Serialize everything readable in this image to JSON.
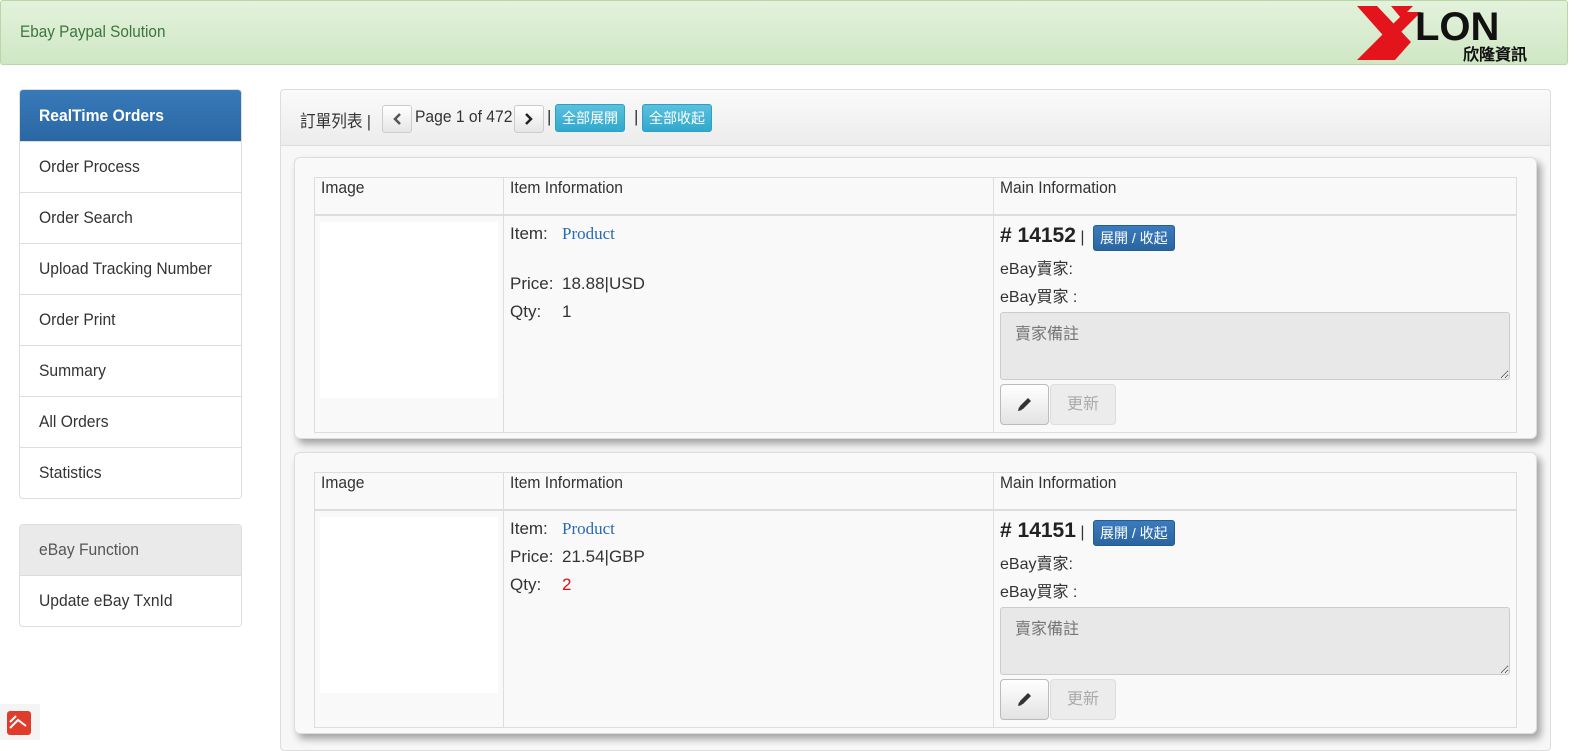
{
  "header": {
    "brand": "Ebay Paypal Solution",
    "logo_text": "LON",
    "logo_sub": "欣隆資訊"
  },
  "sidebar": {
    "items": [
      {
        "label": "RealTime Orders"
      },
      {
        "label": "Order Process"
      },
      {
        "label": "Order Search"
      },
      {
        "label": "Upload Tracking Number"
      },
      {
        "label": "Order Print"
      },
      {
        "label": "Summary"
      },
      {
        "label": "All Orders"
      },
      {
        "label": "Statistics"
      }
    ],
    "group2_heading": "eBay Function",
    "group2_items": [
      {
        "label": "Update eBay TxnId"
      }
    ]
  },
  "toolbar": {
    "title": "訂單列表 |",
    "page_text": "Page 1 of 472",
    "sep1": "|",
    "sep2": "|",
    "expand_all": "全部展開",
    "collapse_all": "全部收起"
  },
  "table_headers": {
    "image": "Image",
    "item_info": "Item Information",
    "main_info": "Main Information"
  },
  "labels": {
    "item": "Item:",
    "price": "Price:",
    "qty": "Qty:",
    "toggle": "展開 / 收起",
    "seller": "eBay賣家:",
    "buyer": "eBay買家 :",
    "note_placeholder": "賣家備註",
    "update": "更新",
    "sep": "|"
  },
  "orders": [
    {
      "number": "# 14152",
      "product": "Product",
      "price": "18.88|USD",
      "qty": "1",
      "qty_color": "#333333"
    },
    {
      "number": "# 14151",
      "product": "Product",
      "price": "21.54|GBP",
      "qty": "2",
      "qty_color": "#e01010"
    }
  ],
  "colors": {
    "active": "#2a68a4",
    "info": "#5bc0de",
    "header_bg": "#d6ebcc",
    "logo_red": "#e3141b"
  }
}
